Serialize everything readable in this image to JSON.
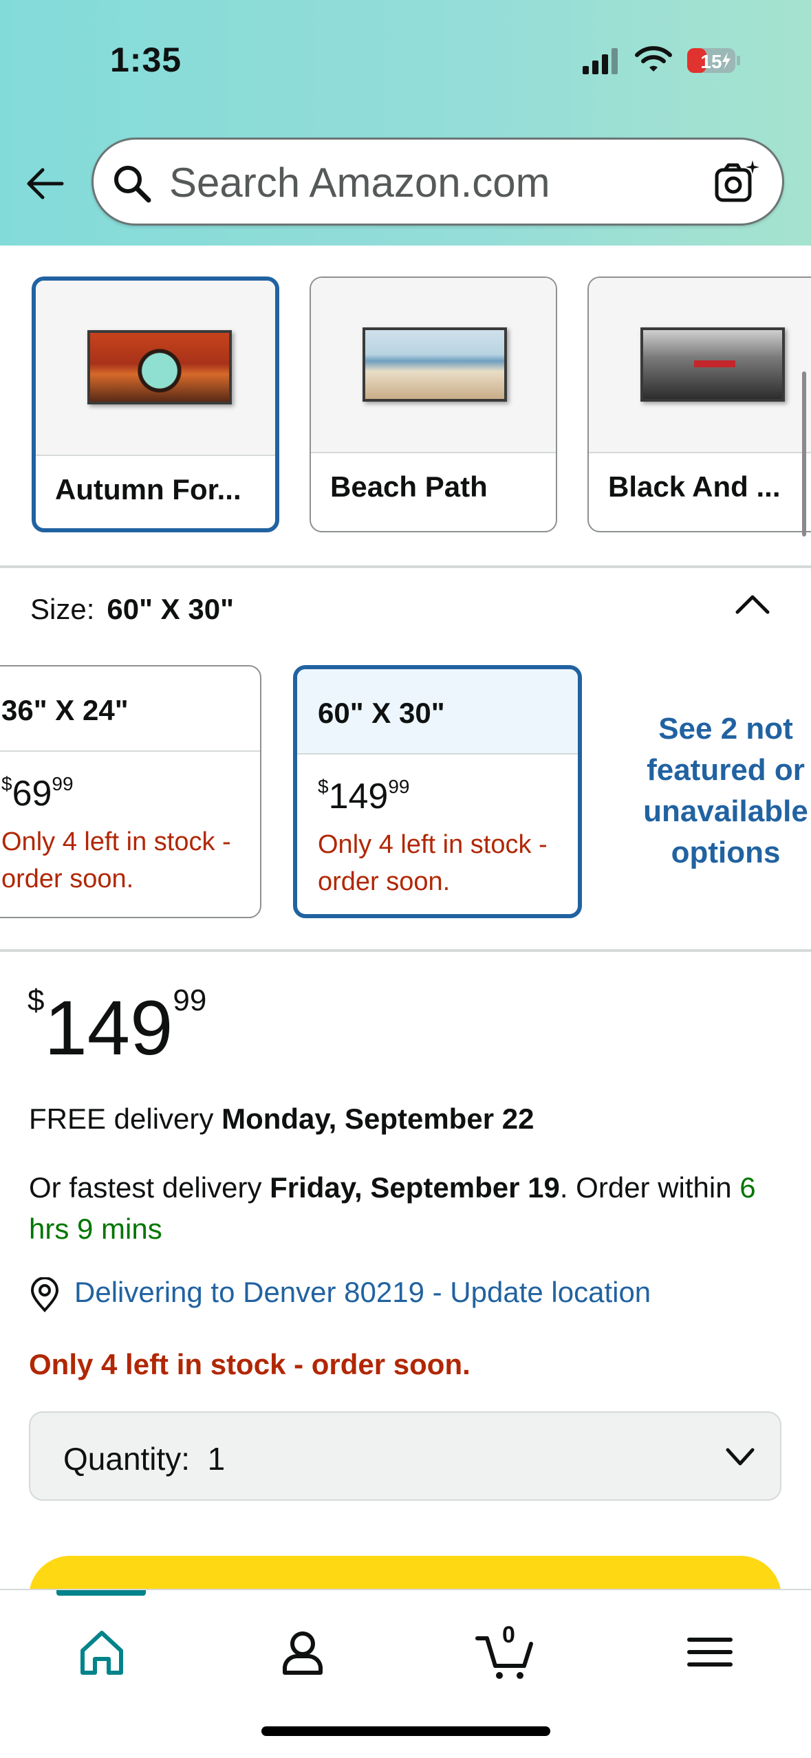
{
  "status_bar": {
    "time": "1:35",
    "battery": "15"
  },
  "search": {
    "placeholder": "Search Amazon.com"
  },
  "styles": [
    {
      "label": "Autumn For...",
      "selected": true
    },
    {
      "label": "Beach Path",
      "selected": false
    },
    {
      "label": "Black And ...",
      "selected": false
    }
  ],
  "size": {
    "label": "Size:",
    "value": "60\" X 30\"",
    "options": [
      {
        "dim": "36\" X 24\"",
        "price_whole": "69",
        "price_frac": "99",
        "currency": "$",
        "stock": "Only 4 left in stock - order soon.",
        "selected": false
      },
      {
        "dim": "60\" X 30\"",
        "price_whole": "149",
        "price_frac": "99",
        "currency": "$",
        "stock": "Only 4 left in stock - order soon.",
        "selected": true
      }
    ],
    "see_more": "See 2 not featured or unavailable options"
  },
  "price": {
    "currency": "$",
    "whole": "149",
    "fraction": "99"
  },
  "delivery": {
    "free_prefix": "FREE delivery ",
    "free_date": "Monday, September 22",
    "fast_prefix": "Or fastest delivery ",
    "fast_date": "Friday, September 19",
    "fast_mid": ". Order within ",
    "countdown": "6 hrs 9 mins"
  },
  "location": {
    "text": "Delivering to Denver 80219 - Update location"
  },
  "stock_notice": "Only 4 left in stock - order soon.",
  "quantity": {
    "label": "Quantity:",
    "value": "1"
  },
  "tabbar": {
    "cart_count": "0"
  },
  "colors": {
    "link": "#2162a1",
    "stock_red": "#b12704",
    "green": "#007600",
    "buy_yellow": "#ffd814",
    "teal": "#00838a"
  }
}
